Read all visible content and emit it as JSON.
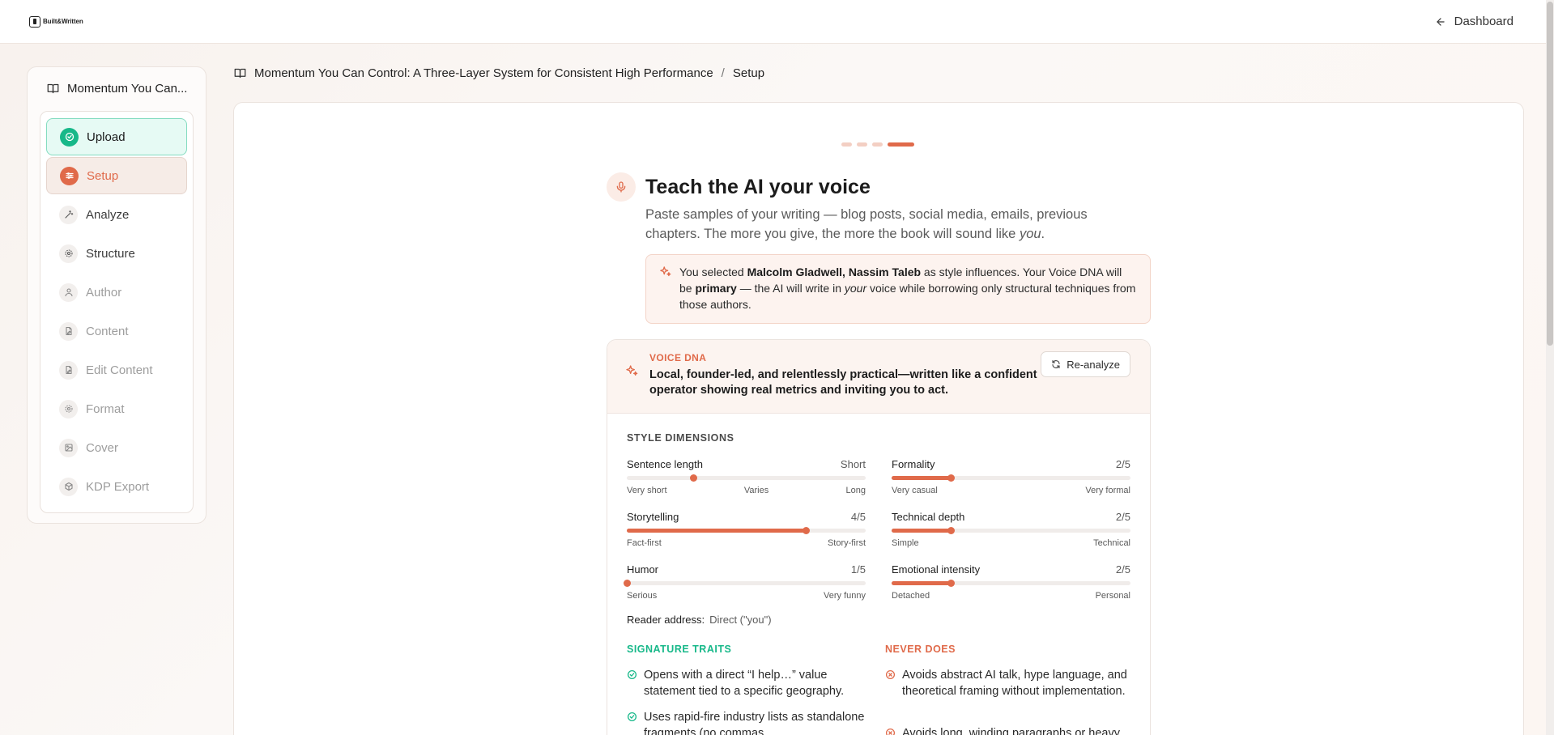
{
  "app": {
    "logo_text": "Built&Written"
  },
  "topbar": {
    "dashboard_label": "Dashboard"
  },
  "sidebar": {
    "book_title": "Momentum You Can...",
    "steps": [
      {
        "label": "Upload",
        "state": "done",
        "icon": "check-circle-icon"
      },
      {
        "label": "Setup",
        "state": "active",
        "icon": "sliders-icon"
      },
      {
        "label": "Analyze",
        "state": "available",
        "icon": "wand-icon"
      },
      {
        "label": "Structure",
        "state": "available",
        "icon": "gear-icon"
      },
      {
        "label": "Author",
        "state": "locked",
        "icon": "user-icon"
      },
      {
        "label": "Content",
        "state": "locked",
        "icon": "file-edit-icon"
      },
      {
        "label": "Edit Content",
        "state": "locked",
        "icon": "file-edit-icon"
      },
      {
        "label": "Format",
        "state": "locked",
        "icon": "gear-icon"
      },
      {
        "label": "Cover",
        "state": "locked",
        "icon": "image-icon"
      },
      {
        "label": "KDP Export",
        "state": "locked",
        "icon": "package-icon"
      }
    ]
  },
  "breadcrumb": {
    "book": "Momentum You Can Control: A Three-Layer System for Consistent High Performance",
    "separator": "/",
    "page": "Setup"
  },
  "wizard": {
    "total_steps": 4,
    "current_step": 4
  },
  "header": {
    "title": "Teach the AI your voice",
    "subtitle_pre": "Paste samples of your writing — blog posts, social media, emails, previous chapters. The more you give, the more the book will sound like ",
    "subtitle_em": "you",
    "subtitle_post": "."
  },
  "notice": {
    "t1": "You selected ",
    "authors": "Malcolm Gladwell, Nassim Taleb",
    "t2": " as style influences. Your Voice DNA will be ",
    "primary": "primary",
    "t3": " — the AI will write in ",
    "your": "your",
    "t4": " voice while borrowing only structural techniques from those authors."
  },
  "voice_dna": {
    "label": "VOICE DNA",
    "summary": "Local, founder-led, and relentlessly practical—written like a confident operator showing real metrics and inviting you to act.",
    "reanalyze_label": "Re-analyze",
    "dims_title": "STYLE DIMENSIONS",
    "dimensions": [
      {
        "name": "Sentence length",
        "value": "Short",
        "level": 0.28,
        "left": "Very short",
        "mid": "Varies",
        "right": "Long",
        "filled": false
      },
      {
        "name": "Formality",
        "value": "2/5",
        "level": 0.25,
        "left": "Very casual",
        "right": "Very formal",
        "filled": true
      },
      {
        "name": "Storytelling",
        "value": "4/5",
        "level": 0.75,
        "left": "Fact-first",
        "right": "Story-first",
        "filled": true
      },
      {
        "name": "Technical depth",
        "value": "2/5",
        "level": 0.25,
        "left": "Simple",
        "right": "Technical",
        "filled": true
      },
      {
        "name": "Humor",
        "value": "1/5",
        "level": 0,
        "left": "Serious",
        "right": "Very funny",
        "filled": true
      },
      {
        "name": "Emotional intensity",
        "value": "2/5",
        "level": 0.25,
        "left": "Detached",
        "right": "Personal",
        "filled": true
      }
    ],
    "reader_label": "Reader address:",
    "reader_value": "Direct (\"you\")",
    "signature_title": "SIGNATURE TRAITS",
    "signature_traits": [
      "Opens with a direct “I help…” value statement tied to a specific geography.",
      "Uses rapid-fire industry lists as standalone fragments (no commas"
    ],
    "never_title": "NEVER DOES",
    "never_does": [
      "Avoids abstract AI talk, hype language, and theoretical framing without implementation.",
      "Avoids long, winding paragraphs or heavy"
    ]
  },
  "colors": {
    "accent": "#e06a4a",
    "success": "#17b889",
    "danger": "#e06a4a"
  }
}
